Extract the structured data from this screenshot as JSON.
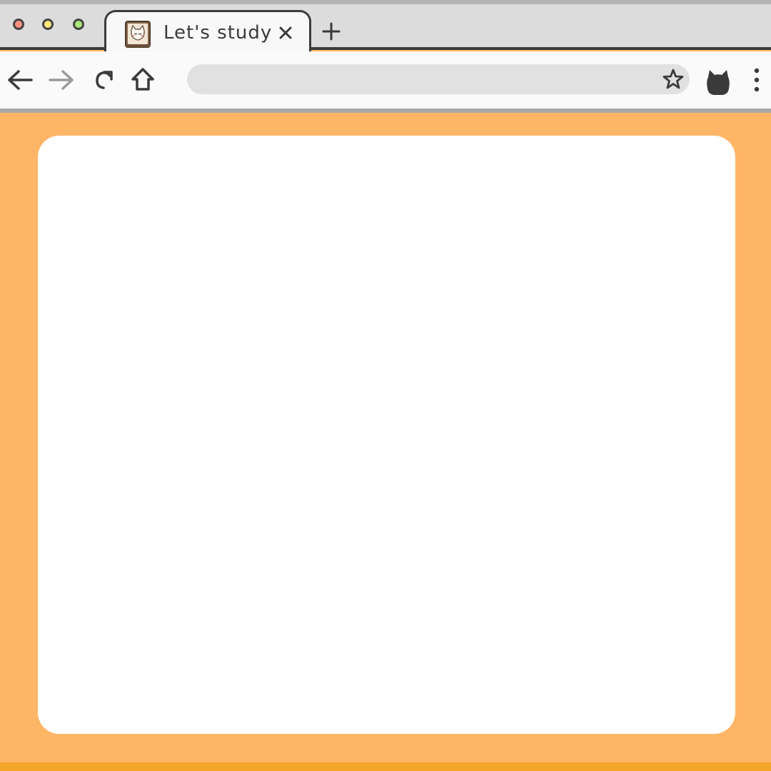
{
  "window": {
    "controls": [
      "close",
      "minimize",
      "maximize"
    ],
    "colors": {
      "close": "#ff8f7e",
      "minimize": "#ffe97a",
      "maximize": "#a9e87a"
    }
  },
  "tab": {
    "title": "Let's study",
    "favicon": "cat-book-icon",
    "close_icon": "close-icon"
  },
  "new_tab_icon": "plus-icon",
  "toolbar": {
    "back_icon": "arrow-left-icon",
    "forward_icon": "arrow-right-icon",
    "reload_icon": "reload-icon",
    "home_icon": "home-icon",
    "address_value": "",
    "bookmark_icon": "star-icon",
    "profile_icon": "cat-silhouette-icon",
    "menu_icon": "vertical-dots-icon"
  },
  "colors": {
    "background": "#ffb566",
    "page": "#ffffff",
    "chrome": "#dcdcdc",
    "toolbar": "#fafafa",
    "outline": "#3c3c3c"
  }
}
